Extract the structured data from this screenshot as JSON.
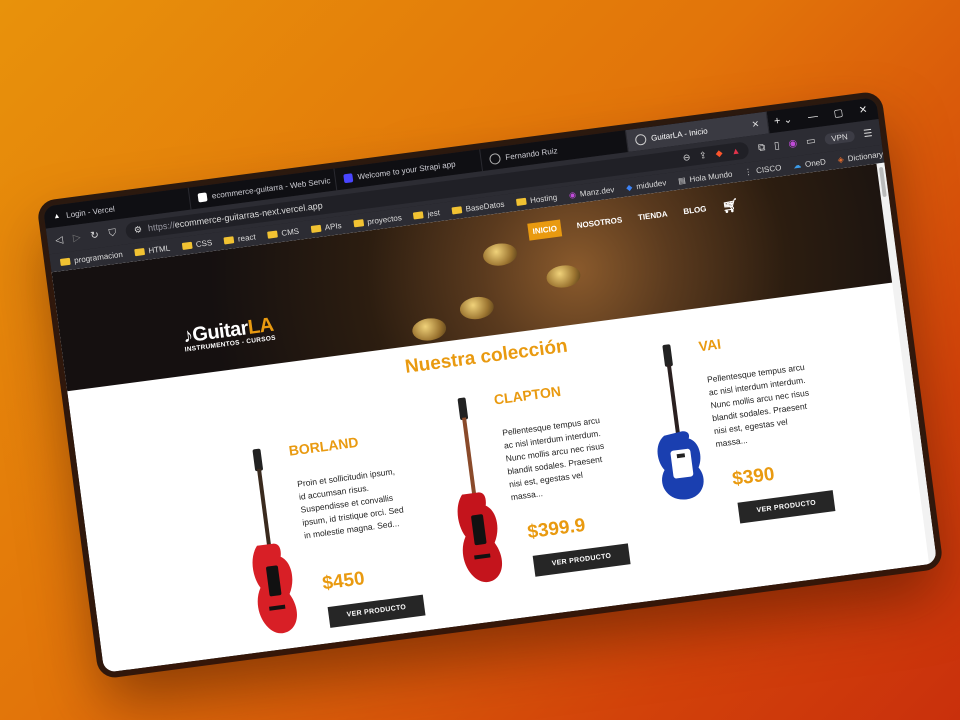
{
  "browser": {
    "tabs": [
      {
        "label": "Login - Vercel",
        "icon": "vercel-icon"
      },
      {
        "label": "ecommerce-guitarra - Web Servic",
        "icon": "site-icon"
      },
      {
        "label": "Welcome to your Strapi app",
        "icon": "strapi-icon"
      },
      {
        "label": "Fernando Ruiz",
        "icon": "globe-icon"
      },
      {
        "label": "GuitarLA - Inicio",
        "icon": "globe-icon",
        "active": true
      }
    ],
    "url": {
      "scheme": "https://",
      "host": "ecommerce-guitarras-next.vercel.app"
    },
    "vpn_label": "VPN",
    "bookmarks": [
      "programacion",
      "HTML",
      "CSS",
      "react",
      "CMS",
      "APIs",
      "proyectos",
      "jest",
      "BaseDatos",
      "Hosting",
      "Manz.dev",
      "midudev",
      "Hola Mundo",
      "CISCO",
      "OneD",
      "Dictionary"
    ]
  },
  "site": {
    "logo_name_a": "Guitar",
    "logo_name_b": "LA",
    "logo_sub": "INSTRUMENTOS - CURSOS",
    "nav": [
      "INICIO",
      "NOSOTROS",
      "TIENDA",
      "BLOG"
    ],
    "active_nav": "INICIO",
    "section_title": "Nuestra colección",
    "button_label": "VER PRODUCTO",
    "products": [
      {
        "name": "BORLAND",
        "desc": "Proin et sollicitudin ipsum, id accumsan risus. Suspendisse et convallis ipsum, id tristique orci. Sed in molestie magna. Sed...",
        "price": "$450",
        "color": "#d81f26"
      },
      {
        "name": "CLAPTON",
        "desc": "Pellentesque tempus arcu ac nisl interdum interdum. Nunc mollis arcu nec risus blandit sodales. Praesent nisi est, egestas vel massa...",
        "price": "$399.9",
        "color": "#c4141c"
      },
      {
        "name": "VAI",
        "desc": "Pellentesque tempus arcu ac nisl interdum interdum. Nunc mollis arcu nec risus blandit sodales. Praesent nisi est, egestas vel massa...",
        "price": "$390",
        "color": "#1a3fb0"
      }
    ]
  },
  "colors": {
    "accent": "#e99a10",
    "button": "#262626"
  }
}
